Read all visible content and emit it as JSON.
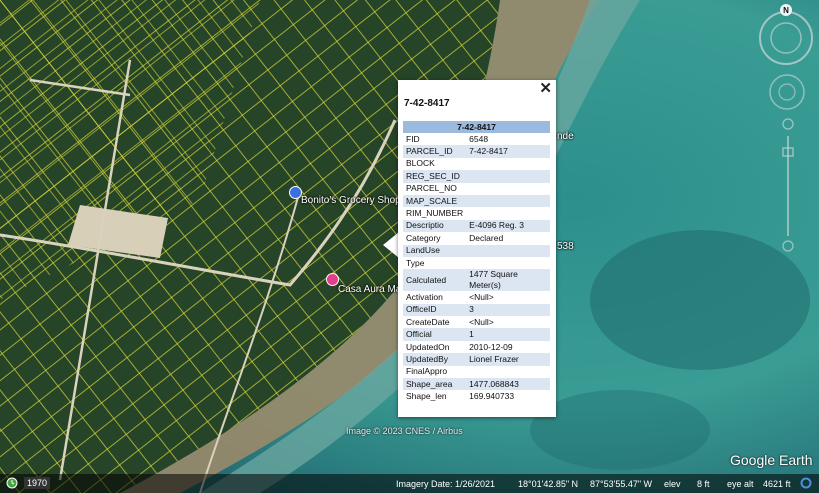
{
  "map": {
    "land_color": "#2a4a2c",
    "water_color": "#2f8f8f",
    "parcel_line_color": "#d8d83a",
    "road_color": "#d9d2bc"
  },
  "pois": [
    {
      "label": "Bonito's Grocery Shop",
      "icon": "shopping-pin-icon",
      "color": "#3b6fe0"
    },
    {
      "label": "Casa Aura Ma",
      "icon": "lodging-pin-icon",
      "color": "#e0408a"
    }
  ],
  "hidden_labels": {
    "partial_right_1": "nde",
    "partial_right_2": "538"
  },
  "popup": {
    "title": "7-42-8417",
    "table_header": "7-42-8417",
    "rows": [
      {
        "key": "FID",
        "value": "6548"
      },
      {
        "key": "PARCEL_ID",
        "value": "7-42-8417"
      },
      {
        "key": "BLOCK",
        "value": ""
      },
      {
        "key": "REG_SEC_ID",
        "value": ""
      },
      {
        "key": "PARCEL_NO",
        "value": ""
      },
      {
        "key": "MAP_SCALE",
        "value": ""
      },
      {
        "key": "RIM_NUMBER",
        "value": ""
      },
      {
        "key": "Descriptio",
        "value": "E-4096 Reg. 3"
      },
      {
        "key": "Category",
        "value": "Declared"
      },
      {
        "key": "LandUse",
        "value": ""
      },
      {
        "key": "Type",
        "value": ""
      },
      {
        "key": "Calculated",
        "value": "1477 Square Meter(s)"
      },
      {
        "key": "Activation",
        "value": "<Null>"
      },
      {
        "key": "OfficeID",
        "value": "3"
      },
      {
        "key": "CreateDate",
        "value": "<Null>"
      },
      {
        "key": "Official",
        "value": "1"
      },
      {
        "key": "UpdatedOn",
        "value": "2010-12-09"
      },
      {
        "key": "UpdatedBy",
        "value": "Lionel Frazer"
      },
      {
        "key": "FinalAppro",
        "value": ""
      },
      {
        "key": "Shape_area",
        "value": "1477.068843"
      },
      {
        "key": "Shape_len",
        "value": "169.940733"
      }
    ],
    "close_label": "✕"
  },
  "attribution": "Image © 2023 CNES / Airbus",
  "brand": "Google Earth",
  "compass_letter": "N",
  "status": {
    "history_year": "1970",
    "imagery_date": "Imagery Date: 1/26/2021",
    "lat": "18°01'42.85\" N",
    "lon": "87°53'55.47\" W",
    "elev_label": "elev",
    "elev_value": "8 ft",
    "eye_alt_label": "eye alt",
    "eye_alt_value": "4621 ft"
  }
}
